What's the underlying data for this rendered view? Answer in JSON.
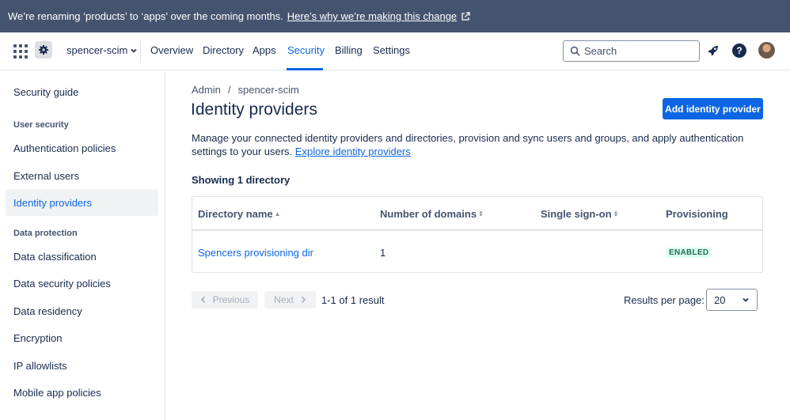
{
  "banner": {
    "text": "We’re renaming ‘products’ to ‘apps’ over the coming months.",
    "link": "Here’s why we’re making this change"
  },
  "topnav": {
    "org_name": "spencer-scim",
    "tabs": [
      "Overview",
      "Directory",
      "Apps",
      "Security",
      "Billing",
      "Settings"
    ],
    "active_tab": "Security",
    "search_placeholder": "Search"
  },
  "sidebar": {
    "items": [
      {
        "label": "Security guide"
      },
      {
        "heading": "User security"
      },
      {
        "label": "Authentication policies"
      },
      {
        "label": "External users"
      },
      {
        "label": "Identity providers",
        "active": true
      },
      {
        "heading": "Data protection"
      },
      {
        "label": "Data classification"
      },
      {
        "label": "Data security policies"
      },
      {
        "label": "Data residency"
      },
      {
        "label": "Encryption"
      },
      {
        "label": "IP allowlists"
      },
      {
        "label": "Mobile app policies"
      }
    ]
  },
  "main": {
    "breadcrumb": [
      "Admin",
      "spencer-scim"
    ],
    "title": "Identity providers",
    "add_button": "Add identity provider",
    "description": "Manage your connected identity providers and directories, provision and sync users and groups, and apply authentication settings to your users.",
    "description_link": "Explore identity providers",
    "showing": "Showing 1 directory",
    "table": {
      "headers": [
        "Directory name",
        "Number of domains",
        "Single sign-on",
        "Provisioning"
      ],
      "rows": [
        {
          "name": "Spencers provisioning dir",
          "domains": "1",
          "sso": "",
          "provisioning": "ENABLED"
        }
      ]
    },
    "pagination": {
      "previous": "Previous",
      "next": "Next",
      "result": "1-1 of 1 result",
      "rpp_label": "Results per page:",
      "rpp_value": "20"
    }
  },
  "colors": {
    "banner_bg": "#44546f",
    "accent": "#0c66e4",
    "enabled_bg": "#dcfff1",
    "enabled_text": "#216e4e"
  }
}
